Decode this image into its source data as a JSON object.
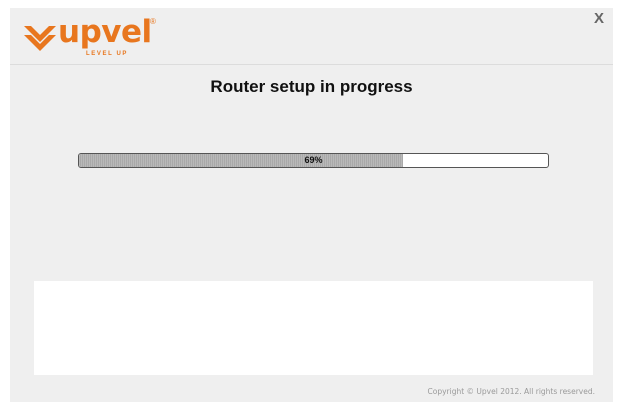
{
  "logo": {
    "word": "upvel",
    "registered": "®",
    "tagline": "LEVEL UP",
    "icon": "upvel-chevron-logo-icon",
    "color": "#e8761e"
  },
  "window": {
    "close_label": "X"
  },
  "main": {
    "title": "Router setup in progress",
    "progress": {
      "value_percent": 69,
      "label": "69%"
    }
  },
  "footer": {
    "copyright": "Copyright © Upvel 2012. All rights reserved."
  }
}
